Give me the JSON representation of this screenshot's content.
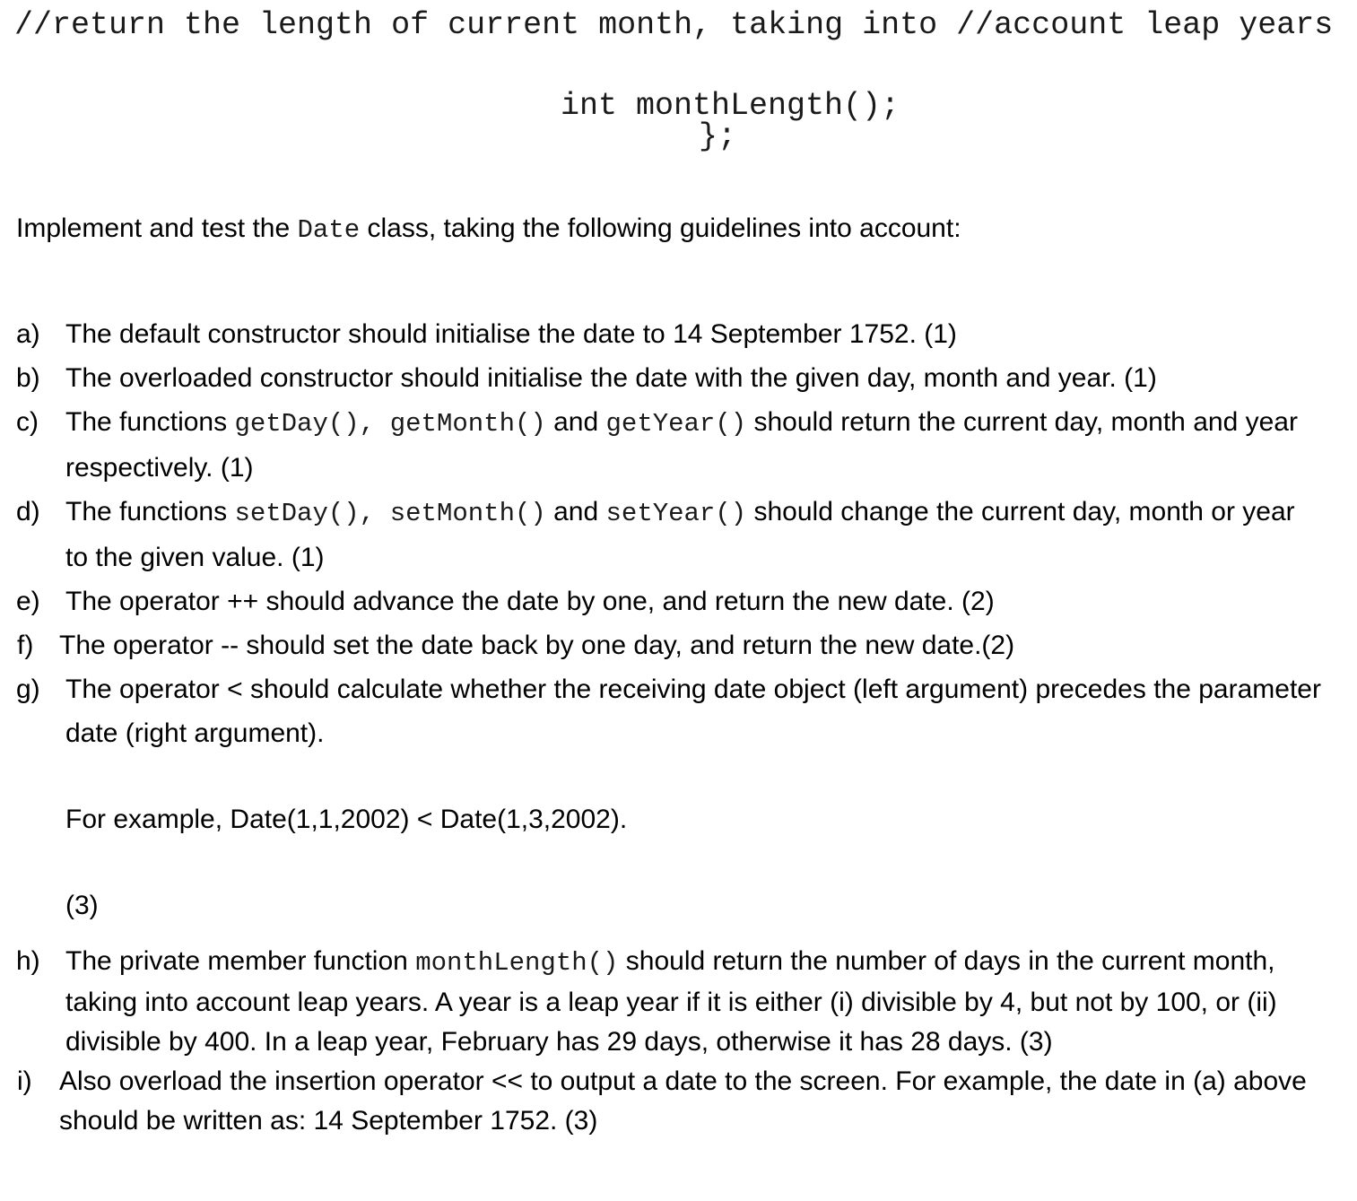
{
  "code": {
    "comment_line": "//return the length of current month, taking into //account leap years",
    "signature_line": "int monthLength();",
    "closing_line": "};"
  },
  "intro": {
    "before_code": "Implement and test the ",
    "code": "Date",
    "after_code": " class, taking the following guidelines into account:"
  },
  "list": {
    "a": {
      "marker": "a)",
      "text": "The default constructor should initialise the date to 14 September 1752. (1)"
    },
    "b": {
      "marker": "b)",
      "text": "The overloaded constructor should initialise the date with the given day, month and year. (1)"
    },
    "c": {
      "marker": "c)",
      "t1": "The functions ",
      "code1": "getDay(),",
      "code2": "getMonth()",
      "t2": " and ",
      "code3": "getYear()",
      "t3": " should return the current day, month and year respectively. (1)"
    },
    "d": {
      "marker": "d)",
      "t1": "The functions ",
      "code1": "setDay(),",
      "code2": "setMonth()",
      "t2": " and ",
      "code3": "setYear()",
      "t3": " should change the current day, month or year to the given value. (1)"
    },
    "e": {
      "marker": "e)",
      "text": "The operator ++ should advance the date by one, and return the new date. (2)"
    },
    "f": {
      "marker": "f)",
      "text": "The operator -- should set the date back by one day, and return the new date.(2)"
    },
    "g": {
      "marker": "g)",
      "text": "The operator < should calculate whether the receiving date object (left argument) precedes the parameter date (right argument).",
      "example": "For example, Date(1,1,2002) < Date(1,3,2002).",
      "score": "(3)"
    },
    "h": {
      "marker": "h)",
      "t1": "The private member function ",
      "code1": "monthLength()",
      "t2": " should return the number of days in the current month, taking into account leap years. A year is a leap year if it is either (i) divisible by 4, but not by 100, or (ii) divisible by 400. In a leap year, February has 29 days, otherwise it has 28 days. (3)"
    },
    "i": {
      "marker": "i)",
      "text": "Also overload the insertion operator << to output a date to the screen. For example, the date in (a) above should be written as: 14 September 1752. (3)"
    }
  }
}
